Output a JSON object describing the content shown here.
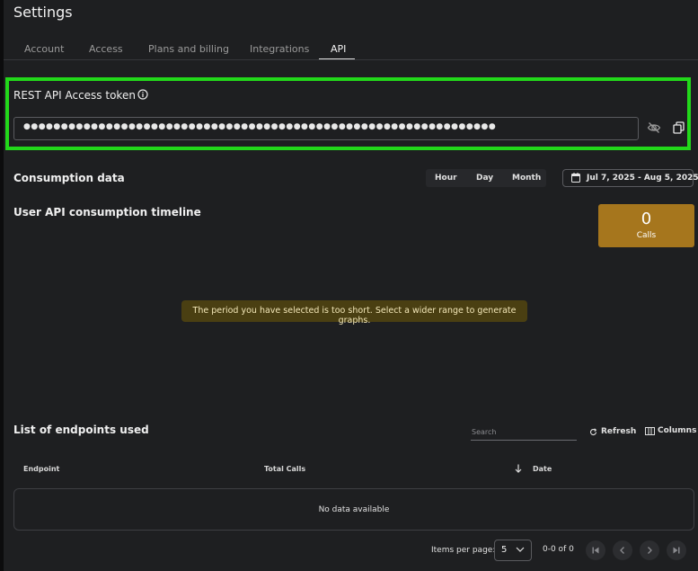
{
  "page": {
    "title": "Settings"
  },
  "tabs": [
    {
      "label": "Account"
    },
    {
      "label": "Access"
    },
    {
      "label": "Plans and billing"
    },
    {
      "label": "Integrations"
    },
    {
      "label": "API",
      "active": true
    }
  ],
  "token": {
    "label": "REST API Access token",
    "masked_value": "●●●●●●●●●●●●●●●●●●●●●●●●●●●●●●●●●●●●●●●●●●●●●●●●●●●●●●●●●●●●●●●",
    "info_icon": "info-icon",
    "visibility_icon": "eye-off-icon",
    "copy_icon": "copy-icon"
  },
  "consumption": {
    "title": "Consumption data",
    "granularity": [
      "Hour",
      "Day",
      "Month"
    ],
    "selected_granularity": "Month",
    "date_range": "Jul 7, 2025 - Aug 5, 2025",
    "timeline_title": "User API consumption timeline",
    "calls_count": "0",
    "calls_label": "Calls",
    "notice": "The period you have selected is too short. Select a wider range to generate graphs."
  },
  "endpoints": {
    "title": "List of endpoints used",
    "search_placeholder": "Search",
    "refresh_label": "Refresh",
    "columns_label": "Columns",
    "columns": [
      "Endpoint",
      "Total Calls",
      "Date"
    ],
    "empty_text": "No data available"
  },
  "pagination": {
    "items_per_page_label": "Items per page:",
    "items_per_page": "5",
    "range": "0-0 of 0"
  },
  "colors": {
    "highlight": "#22d81a",
    "calls_card": "#a6761d",
    "notice_bg": "#4a3f12"
  }
}
